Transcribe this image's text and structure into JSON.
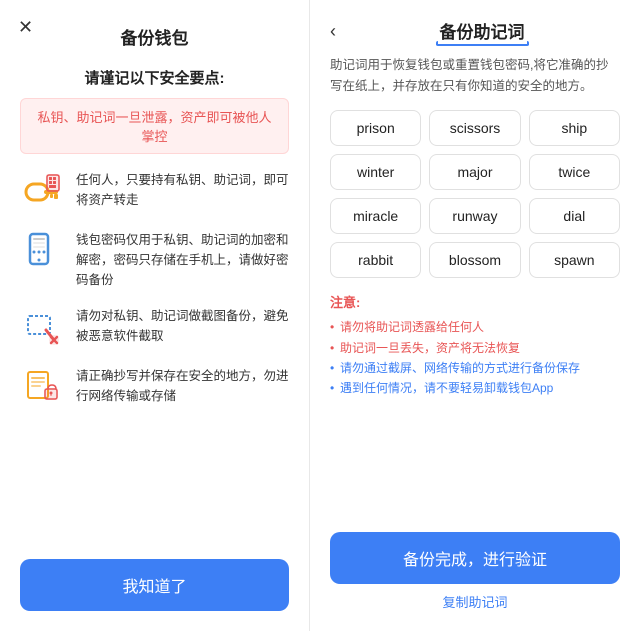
{
  "left": {
    "close_icon": "✕",
    "title": "备份钱包",
    "safety_heading": "请谨记以下安全要点:",
    "warning_text": "私钥、助记词一旦泄露，资产即可被他人掌控",
    "safety_items": [
      {
        "id": "key-item",
        "icon_label": "key-icon",
        "text": "任何人，只要持有私钥、助记词，即可将资产转走"
      },
      {
        "id": "phone-item",
        "icon_label": "phone-icon",
        "text": "钱包密码仅用于私钥、助记词的加密和解密，密码只存储在手机上，请做好密码备份"
      },
      {
        "id": "screenshot-item",
        "icon_label": "screenshot-icon",
        "text": "请勿对私钥、助记词做截图备份，避免被恶意软件截取"
      },
      {
        "id": "paper-item",
        "icon_label": "paper-icon",
        "text": "请正确抄写并保存在安全的地方，勿进行网络传输或存储"
      }
    ],
    "bottom_button": "我知道了"
  },
  "right": {
    "back_icon": "‹",
    "title": "备份助记词",
    "description": "助记词用于恢复钱包或重置钱包密码,将它准确的抄写在纸上，并存放在只有你知道的安全的地方。",
    "words": [
      "prison",
      "scissors",
      "ship",
      "winter",
      "major",
      "twice",
      "miracle",
      "runway",
      "dial",
      "rabbit",
      "blossom",
      "spawn"
    ],
    "notes_title": "注意:",
    "notes": [
      {
        "text": "请勿将助记词透露给任何人",
        "color": "red"
      },
      {
        "text": "助记词一旦丢失，资产将无法恢复",
        "color": "red"
      },
      {
        "text": "请勿通过截屏、网络传输的方式进行备份保存",
        "color": "blue"
      },
      {
        "text": "遇到任何情况，请不要轻易卸载钱包App",
        "color": "blue"
      }
    ],
    "action_button": "备份完成，进行验证",
    "copy_link": "复制助记词"
  }
}
